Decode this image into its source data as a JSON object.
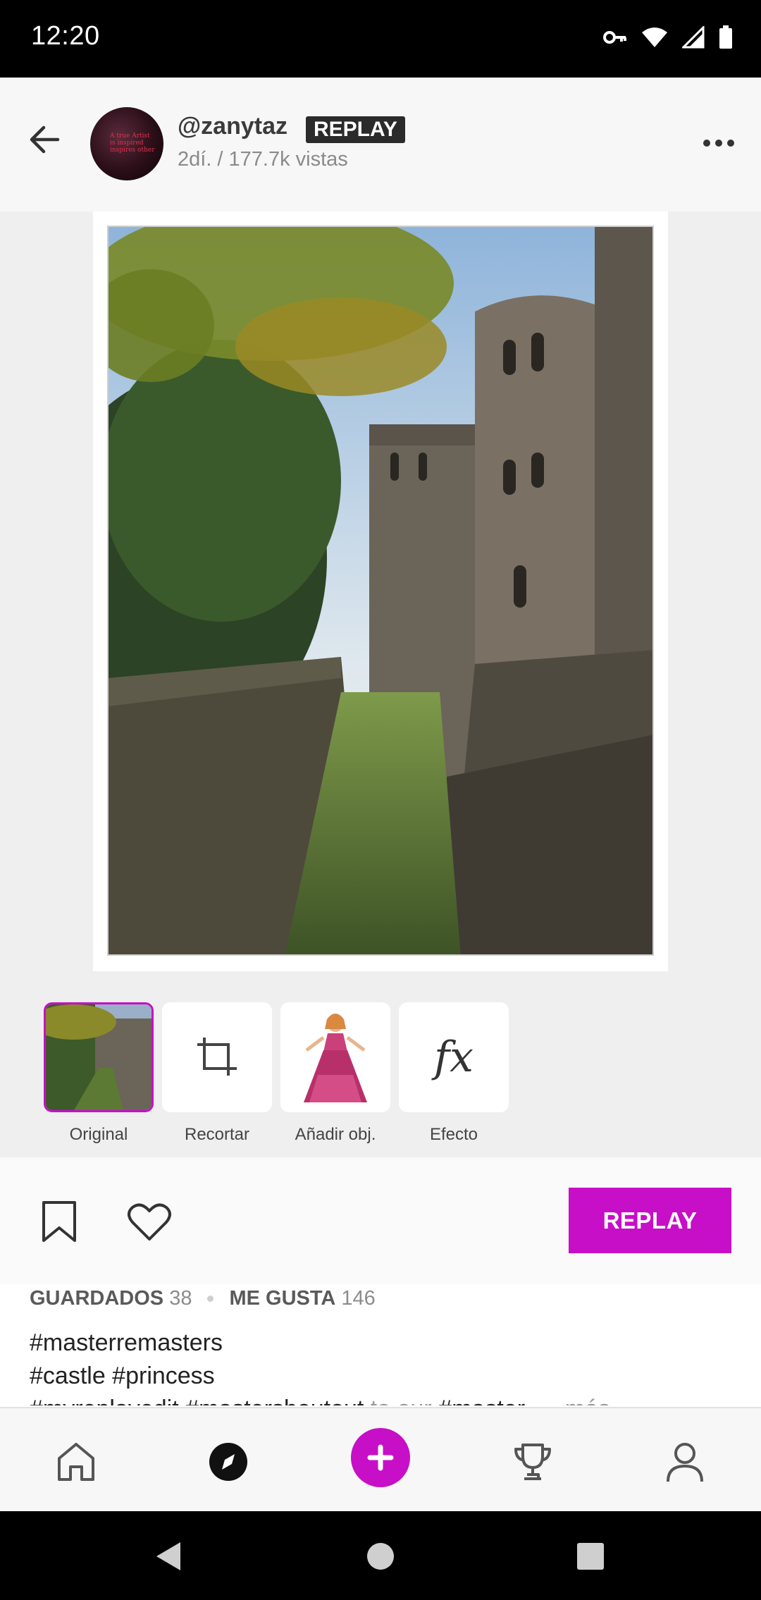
{
  "status_bar": {
    "time": "12:20",
    "icons": [
      "vpn-key-icon",
      "wifi-icon",
      "signal-icon",
      "battery-icon"
    ]
  },
  "header": {
    "username": "@zanytaz",
    "badge": "REPLAY",
    "meta": "2dí. / 177.7k vistas",
    "avatar_text": [
      "A true Artist",
      "is inspired",
      "inspires other"
    ]
  },
  "tools": [
    {
      "label": "Original",
      "selected": true
    },
    {
      "label": "Recortar",
      "icon": "crop-icon"
    },
    {
      "label": "Añadir obj.",
      "icon": "sticker-princess"
    },
    {
      "label": "Efecto",
      "icon": "fx-icon",
      "glyph": "fx"
    }
  ],
  "actions": {
    "replay_label": "REPLAY"
  },
  "stats": {
    "saved_label": "GUARDADOS",
    "saved_count": "38",
    "likes_label": "ME GUSTA",
    "likes_count": "146"
  },
  "caption": {
    "line1": "#masterremasters",
    "line2": "#castle #princess",
    "line3_tags_a": "#myreplayedit #mastershoutout",
    "line3_text": " to our ",
    "line3_tags_b": "#master",
    "more": "... más"
  },
  "bottom_nav": [
    "home-icon",
    "explore-icon",
    "create-icon",
    "trophy-icon",
    "profile-icon"
  ],
  "colors": {
    "accent": "#c70fc7",
    "status_bar": "#000000",
    "badge": "#2b2b2b"
  }
}
